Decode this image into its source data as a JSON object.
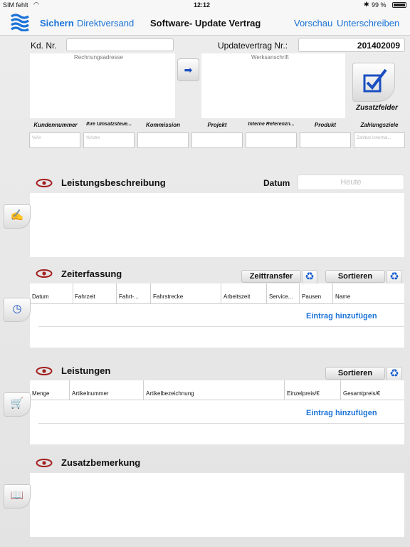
{
  "status": {
    "carrier": "SIM fehlt",
    "time": "12:12",
    "battery": "99 %"
  },
  "nav": {
    "save": "Sichern",
    "direct": "Direktversand",
    "title": "Software- Update Vertrag",
    "preview": "Vorschau",
    "sign": "Unterschreiben"
  },
  "header": {
    "customer_label": "Kd. Nr.",
    "contract_label": "Updatevertrag Nr.:",
    "contract_number": "201402009",
    "billing_address": "Rechnungsadresse",
    "factory_address": "Werksanschrift",
    "extra_fields": "Zusatzfelder"
  },
  "fields": [
    {
      "label": "Kundennummer",
      "placeholder": "%An"
    },
    {
      "label": "Ihre Umsatzsteue...",
      "placeholder": "%Astre"
    },
    {
      "label": "Kommission",
      "placeholder": ""
    },
    {
      "label": "Projekt",
      "placeholder": ""
    },
    {
      "label": "Interne Referenzn...",
      "placeholder": ""
    },
    {
      "label": "Produkt",
      "placeholder": ""
    },
    {
      "label": "Zahlungsziele",
      "placeholder": "Zahlbar innerhal..."
    }
  ],
  "description": {
    "title": "Leistungsbeschreibung",
    "date_label": "Datum",
    "date_placeholder": "Heute"
  },
  "time": {
    "title": "Zeiterfassung",
    "transfer": "Zeittransfer",
    "sort": "Sortieren",
    "columns": [
      "Datum",
      "Fahrzeit",
      "Fahrt-...",
      "Fahrstrecke",
      "Arbeitszeit",
      "Service...",
      "Pausen",
      "Name"
    ],
    "add": "Eintrag hinzufügen"
  },
  "services": {
    "title": "Leistungen",
    "sort": "Sortieren",
    "columns": [
      "Menge",
      "Artikelnummer",
      "Artikelbezeichnung",
      "Einzelpreis/€",
      "Gesamtpreis/€"
    ],
    "add": "Eintrag hinzufügen"
  },
  "remarks": {
    "title": "Zusatzbemerkung"
  },
  "colors": {
    "accent": "#1a73d8",
    "eye": "#a32020",
    "icon_blue": "#1a4fc0"
  },
  "icons": [
    "wifi-icon",
    "bluetooth-icon",
    "battery-icon",
    "app-logo-icon",
    "arrow-right-icon",
    "checkbox-icon",
    "eye-icon",
    "recycle-icon",
    "writing-icon",
    "clock-icon",
    "cart-icon",
    "book-icon"
  ]
}
